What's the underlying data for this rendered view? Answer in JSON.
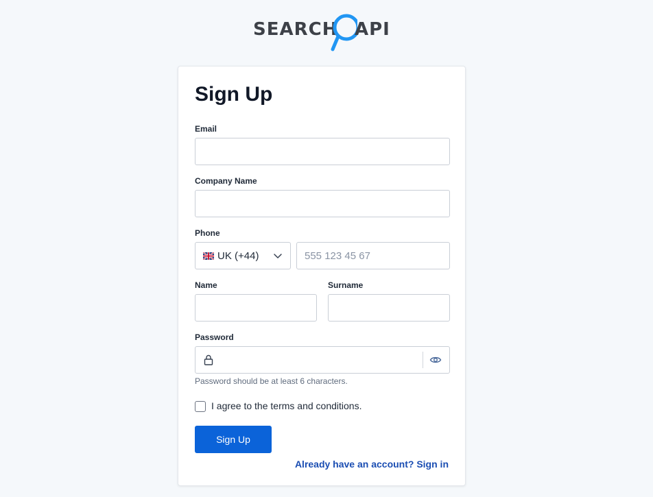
{
  "logo": {
    "left_text": "SEARCH",
    "right_text": "API",
    "brand_color": "#2196f3"
  },
  "form": {
    "title": "Sign Up",
    "email_label": "Email",
    "company_label": "Company Name",
    "phone_label": "Phone",
    "country_value": "UK (+44)",
    "phone_placeholder": "555 123 45 67",
    "name_label": "Name",
    "surname_label": "Surname",
    "password_label": "Password",
    "password_hint": "Password should be at least 6 characters.",
    "terms_label": "I agree to the terms and conditions.",
    "submit_label": "Sign Up",
    "signin_link": "Already have an account? Sign in"
  },
  "icons": {
    "flag": "uk-flag-icon",
    "dropdown": "chevron-down-icon",
    "lock": "lock-icon",
    "eye": "eye-icon",
    "magnifier": "magnifier-icon"
  },
  "colors": {
    "primary": "#0b63d9",
    "link": "#1a4db2",
    "background": "#f5f8fb"
  }
}
